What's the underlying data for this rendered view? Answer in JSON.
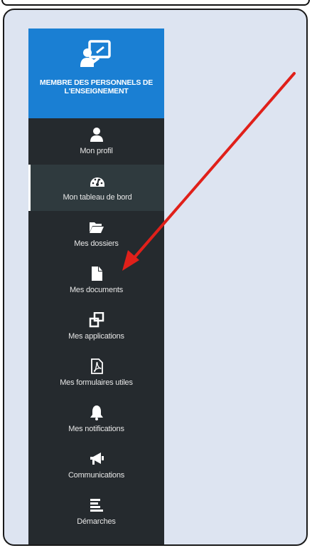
{
  "sidebar": {
    "header": {
      "title": "MEMBRE DES PERSONNELS DE L'ENSEIGNEMENT",
      "icon": "teacher-board-icon",
      "color": "#1a7fd3"
    },
    "background_color": "#252a2e",
    "items": [
      {
        "label": "Mon profil",
        "icon": "user-icon",
        "active": false
      },
      {
        "label": "Mon tableau de bord",
        "icon": "dashboard-icon",
        "active": true
      },
      {
        "label": "Mes dossiers",
        "icon": "folder-open-icon",
        "active": false
      },
      {
        "label": "Mes documents",
        "icon": "document-icon",
        "active": false
      },
      {
        "label": "Mes applications",
        "icon": "applications-icon",
        "active": false
      },
      {
        "label": "Mes formulaires utiles",
        "icon": "pdf-file-icon",
        "active": false
      },
      {
        "label": "Mes notifications",
        "icon": "bell-icon",
        "active": false
      },
      {
        "label": "Communications",
        "icon": "megaphone-icon",
        "active": false
      },
      {
        "label": "Démarches",
        "icon": "list-lines-icon",
        "active": false
      }
    ]
  },
  "annotation": {
    "arrow_color": "#e0201a",
    "points_to": "Mes documents"
  },
  "page_background": "#dde4f1"
}
